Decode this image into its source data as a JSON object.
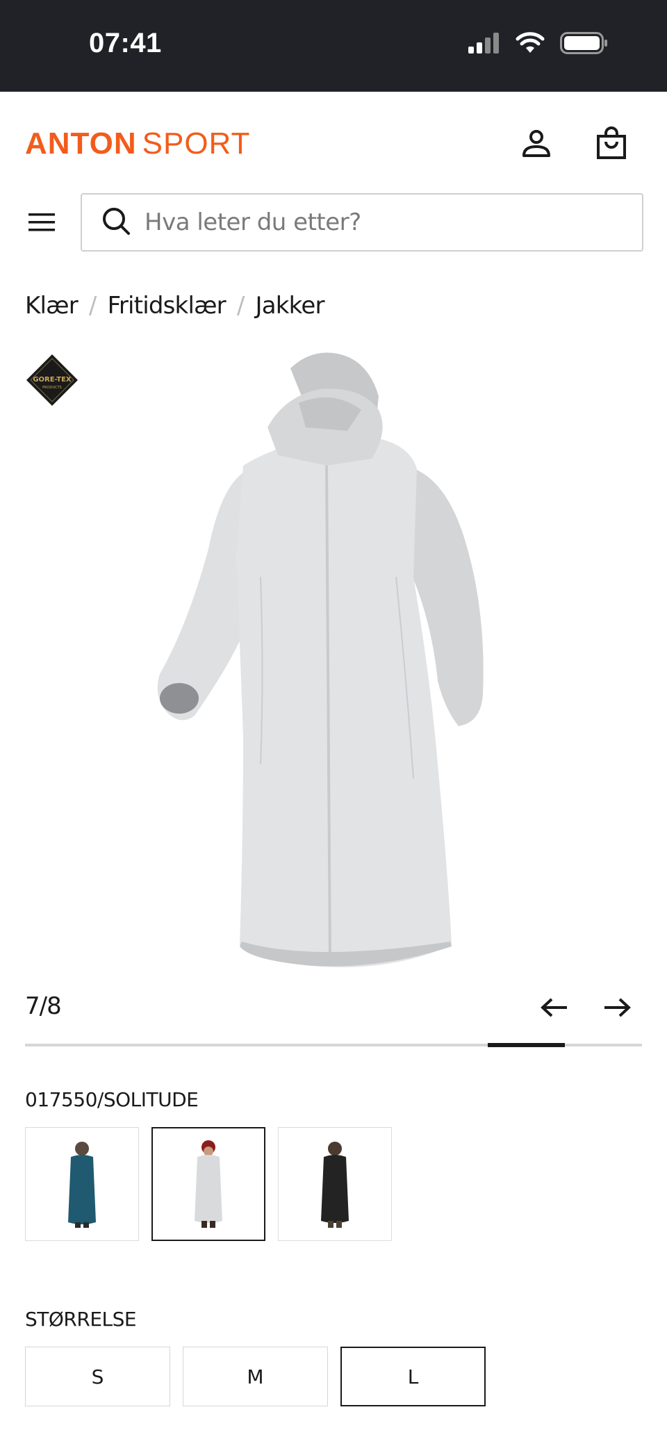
{
  "status_bar": {
    "time": "07:41",
    "icons": [
      "cellular-signal-icon",
      "wifi-icon",
      "battery-icon"
    ]
  },
  "header": {
    "logo_bold": "ANTON",
    "logo_light": "SPORT",
    "icons": [
      "user-icon",
      "shopping-bag-icon"
    ],
    "brand_color": "#f25c1b"
  },
  "search": {
    "placeholder": "Hva leter du etter?",
    "icon": "search-icon"
  },
  "menu": {
    "icon": "hamburger-menu-icon"
  },
  "breadcrumb": {
    "items": [
      "Klær",
      "Fritidsklær",
      "Jakker"
    ],
    "separator": "/"
  },
  "badge": {
    "text": "GORE-TEX",
    "subtext": "PRODUCTS"
  },
  "gallery": {
    "counter": "7/8",
    "current": 7,
    "total": 8,
    "prev_icon": "arrow-left-icon",
    "next_icon": "arrow-right-icon"
  },
  "color_section": {
    "label": "017550/SOLITUDE",
    "swatches": [
      {
        "name": "teal",
        "color": "#1f5a70",
        "selected": false
      },
      {
        "name": "solitude",
        "color": "#d9dadc",
        "selected": true
      },
      {
        "name": "black",
        "color": "#232323",
        "selected": false
      }
    ]
  },
  "size_section": {
    "label": "STØRRELSE",
    "sizes": [
      {
        "label": "S",
        "selected": false
      },
      {
        "label": "M",
        "selected": false
      },
      {
        "label": "L",
        "selected": true
      }
    ]
  }
}
